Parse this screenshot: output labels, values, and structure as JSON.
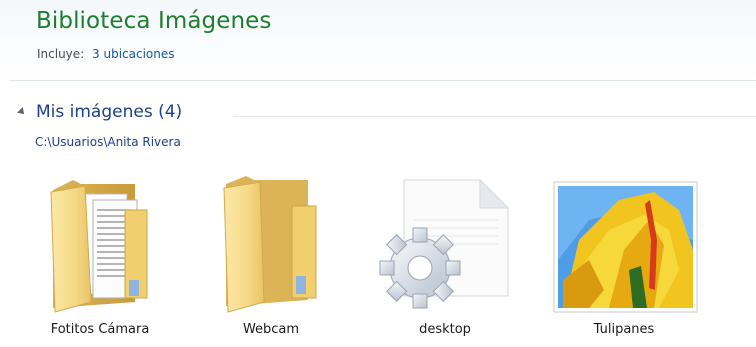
{
  "library": {
    "title": "Biblioteca Imágenes",
    "includes_label": "Incluye:",
    "includes_link": "3 ubicaciones"
  },
  "group": {
    "title": "Mis imágenes (4)",
    "path": "C:\\Usuarios\\Anita Rivera"
  },
  "items": [
    {
      "label": "Fotitos Cámara",
      "icon": "folder-with-documents-icon"
    },
    {
      "label": "Webcam",
      "icon": "folder-icon"
    },
    {
      "label": "desktop",
      "icon": "settings-file-icon"
    },
    {
      "label": "Tulipanes",
      "icon": "image-thumbnail"
    }
  ],
  "colors": {
    "library_title": "#1e7d2e",
    "link": "#0a5aa8",
    "group_title": "#1d3f8c"
  }
}
